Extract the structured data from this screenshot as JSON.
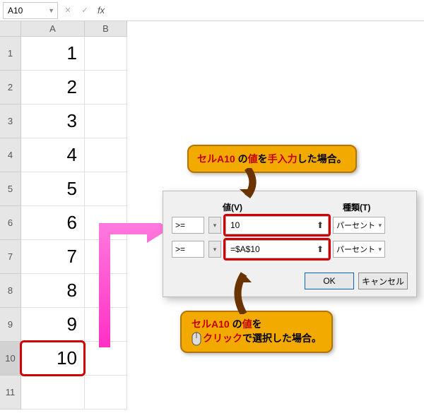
{
  "namebox": {
    "value": "A10",
    "fx": "fx"
  },
  "columns": [
    "A",
    "B"
  ],
  "rows": [
    {
      "n": "1",
      "A": "1",
      "B": ""
    },
    {
      "n": "2",
      "A": "2",
      "B": ""
    },
    {
      "n": "3",
      "A": "3",
      "B": ""
    },
    {
      "n": "4",
      "A": "4",
      "B": ""
    },
    {
      "n": "5",
      "A": "5",
      "B": ""
    },
    {
      "n": "6",
      "A": "6",
      "B": ""
    },
    {
      "n": "7",
      "A": "7",
      "B": ""
    },
    {
      "n": "8",
      "A": "8",
      "B": ""
    },
    {
      "n": "9",
      "A": "9",
      "B": ""
    },
    {
      "n": "10",
      "A": "10",
      "B": ""
    },
    {
      "n": "11",
      "A": "",
      "B": ""
    }
  ],
  "dialog": {
    "labels": {
      "value": "値(V)",
      "type": "種類(T)"
    },
    "row1": {
      "op": ">=",
      "value": "10",
      "type": "パーセント"
    },
    "row2": {
      "op": ">=",
      "value": "=$A$10",
      "type": "パーセント"
    },
    "ok": "OK",
    "cancel": "キャンセル"
  },
  "callout1": {
    "p1": "セルA10",
    "p2": " の",
    "p3": "値",
    "p4": "を",
    "p5": "手入力",
    "p6": "した場合。"
  },
  "callout2": {
    "l1p1": "セルA10",
    "l1p2": " の",
    "l1p3": "値",
    "l1p4": "を",
    "l2p1": "クリック",
    "l2p2": "で選択した場合。"
  }
}
